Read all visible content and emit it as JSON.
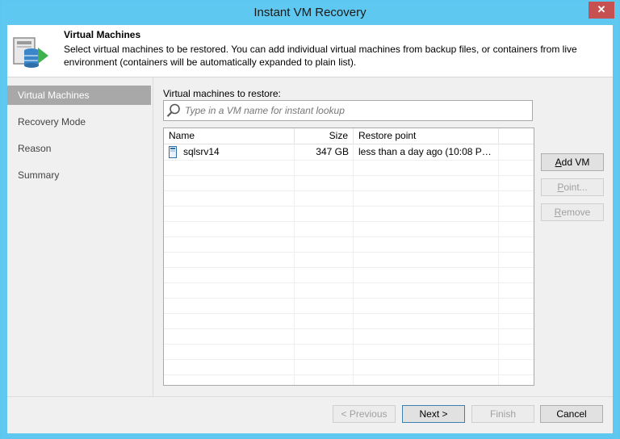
{
  "window": {
    "title": "Instant VM Recovery",
    "close_glyph": "✕"
  },
  "header": {
    "icon": "virtual-machines-restore-icon",
    "title": "Virtual Machines",
    "description": "Select virtual machines to be restored. You  can add individual virtual machines from backup files, or containers from live environment (containers will be automatically expanded to plain list)."
  },
  "nav": {
    "items": [
      {
        "label": "Virtual Machines",
        "active": true
      },
      {
        "label": "Recovery Mode",
        "active": false
      },
      {
        "label": "Reason",
        "active": false
      },
      {
        "label": "Summary",
        "active": false
      }
    ]
  },
  "main": {
    "vm_label": "Virtual machines to restore:",
    "search": {
      "placeholder": "Type in a VM name for instant lookup",
      "value": "",
      "icon": "search-icon"
    },
    "table": {
      "columns": [
        "Name",
        "Size",
        "Restore point"
      ],
      "rows": [
        {
          "name": "sqlsrv14",
          "size": "347 GB",
          "restore_point": "less than a day ago (10:08 PM ...",
          "icon": "vm-file-icon"
        }
      ]
    },
    "buttons": {
      "add_vm": {
        "prefix": "A",
        "rest": "dd VM",
        "enabled": true
      },
      "point": {
        "prefix": "P",
        "rest": "oint...",
        "enabled": false
      },
      "remove": {
        "prefix": "R",
        "rest": "emove",
        "enabled": false
      }
    }
  },
  "footer": {
    "previous": {
      "label": "< Previous",
      "enabled": false
    },
    "next": {
      "label": "Next >",
      "enabled": true
    },
    "finish": {
      "label": "Finish",
      "enabled": false
    },
    "cancel": {
      "label": "Cancel",
      "enabled": true
    }
  },
  "colors": {
    "title_bar": "#5fc8f0",
    "close_button": "#c75050",
    "nav_active": "#a8a8a8",
    "panel_bg": "#f0f0f0"
  }
}
